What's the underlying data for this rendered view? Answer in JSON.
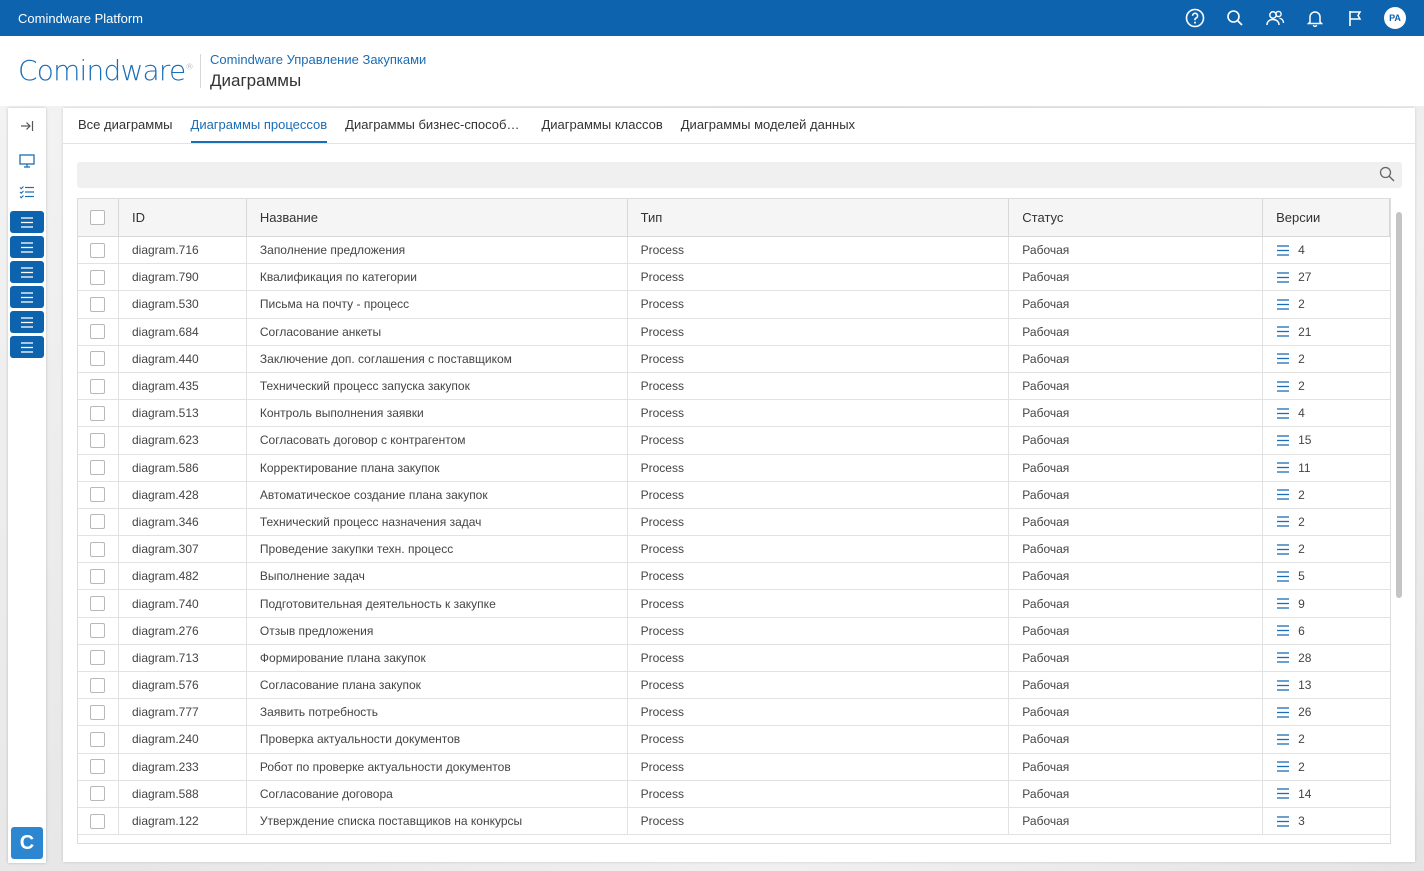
{
  "topbar": {
    "app_title": "Comindware Platform",
    "avatar_initials": "PA"
  },
  "header": {
    "logo_text": "Comindware",
    "app_name": "Comindware Управление Закупками",
    "page_title": "Диаграммы"
  },
  "tabs": [
    {
      "label": "Все диаграммы",
      "active": false
    },
    {
      "label": "Диаграммы процессов",
      "active": true
    },
    {
      "label": "Диаграммы бизнес-способ…",
      "active": false
    },
    {
      "label": "Диаграммы классов",
      "active": false
    },
    {
      "label": "Диаграммы моделей данных",
      "active": false
    }
  ],
  "search": {
    "placeholder": ""
  },
  "colors": {
    "brand": "#0d63ad",
    "accent": "#1b6db5"
  },
  "table": {
    "columns": {
      "id": "ID",
      "name": "Название",
      "type": "Тип",
      "status": "Статус",
      "versions": "Версии"
    },
    "rows": [
      {
        "id": "diagram.716",
        "name": "Заполнение предложения",
        "type": "Process",
        "status": "Рабочая",
        "versions": "4"
      },
      {
        "id": "diagram.790",
        "name": "Квалификация по категории",
        "type": "Process",
        "status": "Рабочая",
        "versions": "27"
      },
      {
        "id": "diagram.530",
        "name": "Письма на почту - процесс",
        "type": "Process",
        "status": "Рабочая",
        "versions": "2"
      },
      {
        "id": "diagram.684",
        "name": "Согласование анкеты",
        "type": "Process",
        "status": "Рабочая",
        "versions": "21"
      },
      {
        "id": "diagram.440",
        "name": "Заключение доп. соглашения с поставщиком",
        "type": "Process",
        "status": "Рабочая",
        "versions": "2"
      },
      {
        "id": "diagram.435",
        "name": "Технический процесс запуска закупок",
        "type": "Process",
        "status": "Рабочая",
        "versions": "2"
      },
      {
        "id": "diagram.513",
        "name": "Контроль выполнения заявки",
        "type": "Process",
        "status": "Рабочая",
        "versions": "4"
      },
      {
        "id": "diagram.623",
        "name": "Согласовать договор с контрагентом",
        "type": "Process",
        "status": "Рабочая",
        "versions": "15"
      },
      {
        "id": "diagram.586",
        "name": "Корректирование плана закупок",
        "type": "Process",
        "status": "Рабочая",
        "versions": "11"
      },
      {
        "id": "diagram.428",
        "name": "Автоматическое создание плана закупок",
        "type": "Process",
        "status": "Рабочая",
        "versions": "2"
      },
      {
        "id": "diagram.346",
        "name": "Технический процесс назначения задач",
        "type": "Process",
        "status": "Рабочая",
        "versions": "2"
      },
      {
        "id": "diagram.307",
        "name": "Проведение закупки техн. процесс",
        "type": "Process",
        "status": "Рабочая",
        "versions": "2"
      },
      {
        "id": "diagram.482",
        "name": "Выполнение задач",
        "type": "Process",
        "status": "Рабочая",
        "versions": "5"
      },
      {
        "id": "diagram.740",
        "name": "Подготовительная деятельность к закупке",
        "type": "Process",
        "status": "Рабочая",
        "versions": "9"
      },
      {
        "id": "diagram.276",
        "name": "Отзыв предложения",
        "type": "Process",
        "status": "Рабочая",
        "versions": "6"
      },
      {
        "id": "diagram.713",
        "name": "Формирование плана закупок",
        "type": "Process",
        "status": "Рабочая",
        "versions": "28"
      },
      {
        "id": "diagram.576",
        "name": "Согласование плана закупок",
        "type": "Process",
        "status": "Рабочая",
        "versions": "13"
      },
      {
        "id": "diagram.777",
        "name": "Заявить потребность",
        "type": "Process",
        "status": "Рабочая",
        "versions": "26"
      },
      {
        "id": "diagram.240",
        "name": "Проверка актуальности документов",
        "type": "Process",
        "status": "Рабочая",
        "versions": "2"
      },
      {
        "id": "diagram.233",
        "name": "Робот по проверке актуальности документов",
        "type": "Process",
        "status": "Рабочая",
        "versions": "2"
      },
      {
        "id": "diagram.588",
        "name": "Согласование договора",
        "type": "Process",
        "status": "Рабочая",
        "versions": "14"
      },
      {
        "id": "diagram.122",
        "name": "Утверждение списка поставщиков на конкурсы",
        "type": "Process",
        "status": "Рабочая",
        "versions": "3"
      }
    ]
  },
  "sidebar": {
    "logo_letter": "C"
  }
}
